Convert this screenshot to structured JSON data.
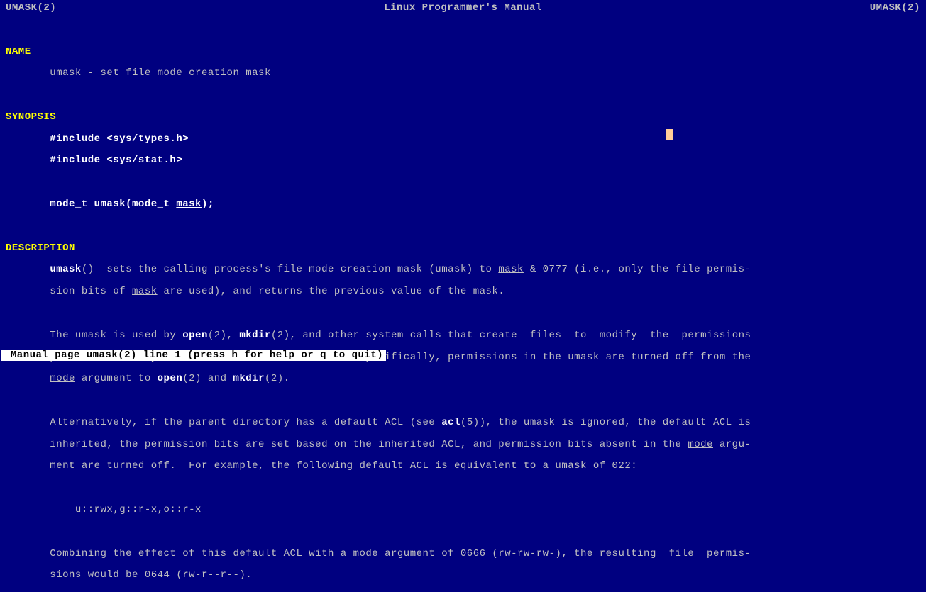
{
  "header": {
    "left": "UMASK(2)",
    "center": "Linux Programmer's Manual",
    "right": "UMASK(2)"
  },
  "name": {
    "heading": "NAME",
    "line": "       umask - set file mode creation mask"
  },
  "synopsis": {
    "heading": "SYNOPSIS",
    "inc1a": "       #include ",
    "inc1b": "<sys/types.h>",
    "inc2a": "       #include ",
    "inc2b": "<sys/stat.h>",
    "sig_a": "       mode_t umask(mode_t ",
    "sig_b": "mask",
    "sig_c": ");"
  },
  "description": {
    "heading": "DESCRIPTION",
    "p1_a": "       ",
    "p1_b": "umask",
    "p1_c": "()  sets the calling process's file mode creation mask (umask) to ",
    "p1_d": "mask",
    "p1_e": " & 0777 (i.e., only the file permis‐",
    "p2_a": "       sion bits of ",
    "p2_b": "mask",
    "p2_c": " are used), and returns the previous value of the mask.",
    "p3_a": "       The umask is used by ",
    "p3_b": "open",
    "p3_c": "(2), ",
    "p3_d": "mkdir",
    "p3_e": "(2), and other system calls that create  files  to  modify  the  permissions",
    "p4_a": "       placed  on  newly created files or directories.  Specifically, permissions in the umask are turned off from the",
    "p5_a": "       ",
    "p5_b": "mode",
    "p5_c": " argument to ",
    "p5_d": "open",
    "p5_e": "(2) and ",
    "p5_f": "mkdir",
    "p5_g": "(2).",
    "p6_a": "       Alternatively, if the parent directory has a default ACL (see ",
    "p6_b": "acl",
    "p6_c": "(5)), the umask is ignored, the default ACL is",
    "p7_a": "       inherited, the permission bits are set based on the inherited ACL, and permission bits absent in the ",
    "p7_b": "mode",
    "p7_c": " argu‐",
    "p8_a": "       ment are turned off.  For example, the following default ACL is equivalent to a umask of 022:",
    "p9_a": "           u::rwx,g::r-x,o::r-x",
    "p10_a": "       Combining the effect of this default ACL with a ",
    "p10_b": "mode",
    "p10_c": " argument of 0666 (rw-rw-rw-), the resulting  file  permis‐",
    "p11_a": "       sions would be 0644 (rw-r--r--)."
  },
  "statusbar": " Manual page umask(2) line 1 (press h for help or q to quit)"
}
